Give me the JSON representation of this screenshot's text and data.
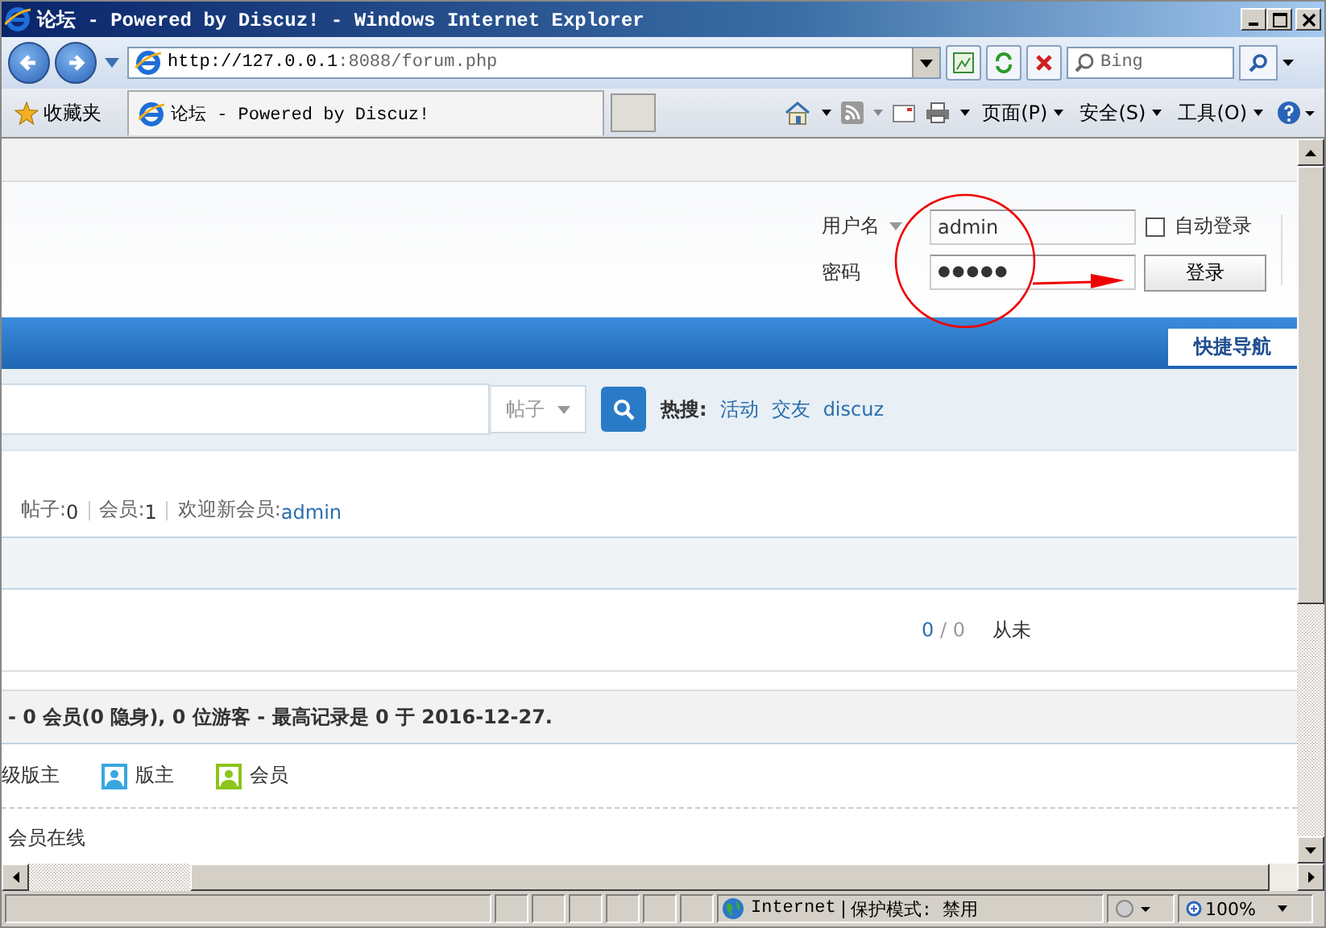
{
  "window": {
    "title": "论坛 - Powered by Discuz! - Windows Internet Explorer"
  },
  "address_bar": {
    "url_host": "http://127.0.0.1",
    "url_rest": ":8088/forum.php",
    "search_placeholder": "Bing"
  },
  "favorites_bar": {
    "favorites_label": "收藏夹",
    "tab_title": "论坛 - Powered by Discuz!",
    "menus": [
      "页面(P)",
      "安全(S)",
      "工具(O)"
    ]
  },
  "login": {
    "username_label": "用户名",
    "username_value": "admin",
    "password_label": "密码",
    "password_dots": "●●●●●",
    "auto_login_label": "自动登录",
    "auto_login_checked": false,
    "login_button": "登录"
  },
  "nav": {
    "quick_nav": "快捷导航"
  },
  "search": {
    "type_label": "帖子",
    "hot_label": "热搜:",
    "hot_links": [
      "活动",
      "交友",
      "discuz"
    ]
  },
  "stats": [
    {
      "label": "帖子:",
      "value": "0",
      "kind": "plain"
    },
    {
      "label": "会员:",
      "value": "1",
      "kind": "plain"
    },
    {
      "label": "欢迎新会员:",
      "value": "admin",
      "kind": "link"
    }
  ],
  "forum_row": {
    "posts": "0",
    "separator": "/",
    "replies": "0",
    "last_post": "从未"
  },
  "online": {
    "summary": "- 0 会员(0 隐身), 0 位游客 - 最高记录是 0 于 2016-12-27.",
    "legend": [
      {
        "label": "级版主"
      },
      {
        "label": "版主",
        "color": "#3aa6e0"
      },
      {
        "label": "会员",
        "color": "#8cc41a"
      }
    ],
    "members_online": "会员在线"
  },
  "status_bar": {
    "zone": "Internet",
    "protected_mode": "保护模式: 禁用",
    "zoom": "100%"
  }
}
